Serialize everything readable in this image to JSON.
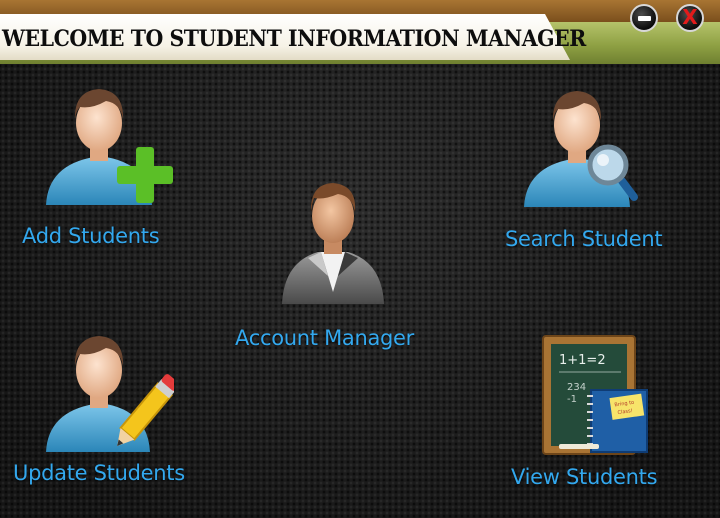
{
  "window": {
    "title": "WELCOME TO STUDENT INFORMATION MANAGER",
    "minimize_icon": "minimize-icon",
    "close_icon": "close-icon",
    "close_glyph": "X"
  },
  "menu": {
    "add_students": {
      "label": "Add Students",
      "icon": "user-add-icon"
    },
    "search_student": {
      "label": "Search Student",
      "icon": "user-search-icon"
    },
    "account_manager": {
      "label": "Account Manager",
      "icon": "account-manager-icon"
    },
    "update_students": {
      "label": "Update Students",
      "icon": "user-edit-icon"
    },
    "view_students": {
      "label": "View Students",
      "icon": "chalkboard-icon",
      "board_text": "1+1=2",
      "board_sum": "234\n-1",
      "note_text": "Bring to Class!"
    }
  },
  "colors": {
    "label": "#33a8ee",
    "title_green": "#8fa144",
    "title_brown": "#8b5a24",
    "close_x": "#e21b1b"
  }
}
